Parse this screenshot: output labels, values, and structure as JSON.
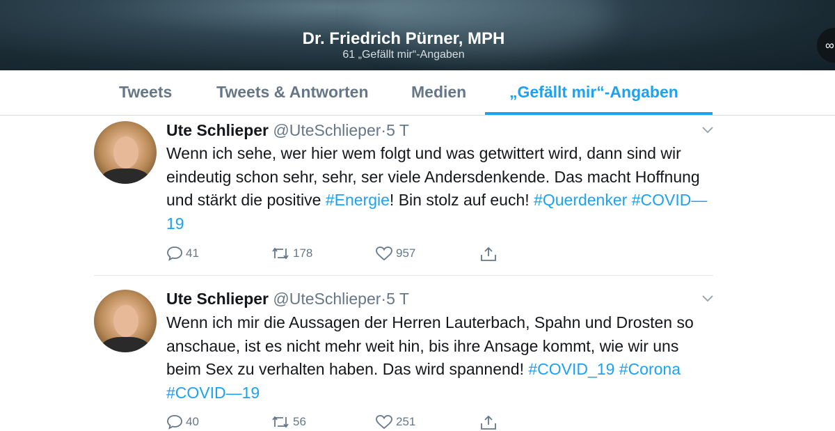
{
  "header": {
    "title": "Dr. Friedrich Pürner, MPH",
    "subtitle": "61 „Gefällt mir“-Angaben",
    "more_label": "∞"
  },
  "tabs": [
    {
      "label": "Tweets",
      "active": false
    },
    {
      "label": "Tweets & Antworten",
      "active": false
    },
    {
      "label": "Medien",
      "active": false
    },
    {
      "label": "„Gefällt mir“-Angaben",
      "active": true
    }
  ],
  "colors": {
    "accent": "#1da1f2",
    "muted": "#657786"
  },
  "tweets": [
    {
      "name": "Ute Schlieper",
      "handle": "@UteSchlieper",
      "sep": "·",
      "time": "5 T",
      "text": [
        {
          "t": "Wenn ich sehe, wer hier wem folgt und was getwittert wird, dann sind wir eindeutig schon sehr, sehr, ser viele Andersdenkende. Das macht Hoffnung und stärkt die positive ",
          "tag": false
        },
        {
          "t": "#Energie",
          "tag": true
        },
        {
          "t": "! Bin stolz auf euch! ",
          "tag": false
        },
        {
          "t": "#Querdenker",
          "tag": true
        },
        {
          "t": " ",
          "tag": false
        },
        {
          "t": "#COVID—19",
          "tag": true
        }
      ],
      "replies": "41",
      "retweets": "178",
      "likes": "957"
    },
    {
      "name": "Ute Schlieper",
      "handle": "@UteSchlieper",
      "sep": "·",
      "time": "5 T",
      "text": [
        {
          "t": "Wenn ich mir die Aussagen der Herren Lauterbach, Spahn und Drosten so anschaue, ist es nicht mehr weit hin, bis ihre Ansage kommt, wie wir uns beim Sex zu verhalten haben. Das wird spannend! ",
          "tag": false
        },
        {
          "t": "#COVID_19",
          "tag": true
        },
        {
          "t": " ",
          "tag": false
        },
        {
          "t": "#Corona",
          "tag": true
        },
        {
          "t": " ",
          "tag": false
        },
        {
          "t": "#COVID—19",
          "tag": true
        }
      ],
      "replies": "40",
      "retweets": "56",
      "likes": "251"
    }
  ]
}
